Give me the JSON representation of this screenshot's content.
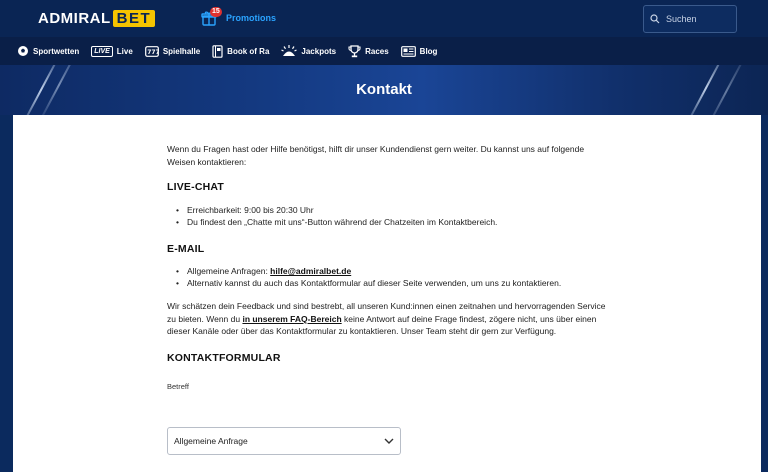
{
  "header": {
    "logo_left": "ADMIRAL",
    "logo_right": "BET",
    "promo_badge": "15",
    "promo_label": "Promotions",
    "search_placeholder": "Suchen"
  },
  "nav": {
    "items": [
      {
        "label": "Sportwetten",
        "icon": "soccer-ball-icon"
      },
      {
        "label": "Live",
        "icon": "live-icon",
        "icon_text": "LIVE"
      },
      {
        "label": "Spielhalle",
        "icon": "slot-machine-icon"
      },
      {
        "label": "Book of Ra",
        "icon": "book-icon"
      },
      {
        "label": "Jackpots",
        "icon": "jackpot-icon"
      },
      {
        "label": "Races",
        "icon": "trophy-icon"
      },
      {
        "label": "Blog",
        "icon": "blog-icon"
      }
    ]
  },
  "hero": {
    "title": "Kontakt"
  },
  "content": {
    "intro": "Wenn du Fragen hast oder Hilfe benötigst, hilft dir unser Kundendienst gern weiter. Du kannst uns auf folgende Weisen kontaktieren:",
    "live_chat": {
      "heading": "LIVE-CHAT",
      "items": [
        "Erreichbarkeit: 9:00 bis 20:30 Uhr",
        "Du findest den „Chatte mit uns“-Button während der Chatzeiten im Kontaktbereich."
      ]
    },
    "email": {
      "heading": "E-MAIL",
      "item1_prefix": "Allgemeine Anfragen: ",
      "item1_link": "hilfe@admiralbet.de",
      "item2": "Alternativ kannst du auch das Kontaktformular auf dieser Seite verwenden, um uns zu kontaktieren."
    },
    "feedback": {
      "part1": "Wir schätzen dein Feedback und sind bestrebt, all unseren Kund:innen einen zeitnahen und hervorragenden Service zu bieten. Wenn du ",
      "link": "in unserem FAQ-Bereich",
      "part2": " keine Antwort auf deine Frage findest, zögere nicht, uns über einen dieser Kanäle oder über das Kontaktformular zu kontaktieren. Unser Team steht dir gern zur Verfügung."
    },
    "form": {
      "heading": "KONTAKTFORMULAR",
      "betreff_label": "Betreff",
      "betreff_value": "Allgemeine Anfrage"
    }
  },
  "colors": {
    "header_bg": "#0a2554",
    "nav_bg": "#0a1f48",
    "brand_yellow": "#f5c400",
    "promo_blue": "#2aa3ff",
    "badge_red": "#e0312f"
  }
}
